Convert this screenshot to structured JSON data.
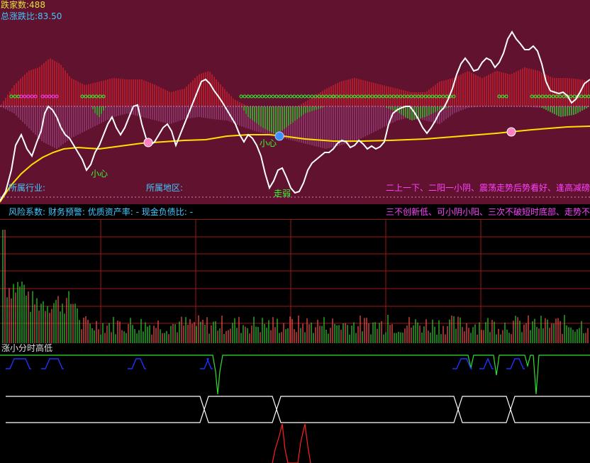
{
  "header": {
    "fall_count_label": "跌家数:",
    "fall_count_value": "488",
    "ratio_label": "总涨跌比:",
    "ratio_value": "83.50"
  },
  "annotations": {
    "xiaoxin_1": "小心",
    "xiaoxin_2": "小心",
    "zouruo": "走弱",
    "industry_label": "所属行业:",
    "region_label": "所属地区:",
    "tip_1": "二上一下、二阳一小阴、震荡走势后势看好、逢高减磅",
    "tip_2": "三不创新低、可小阴小阳、三次不破短时底部、走势不"
  },
  "risk_bar": {
    "text": "风险系数: 财务预警: 优质资产率: - 现金负债比: -"
  },
  "sub_panel": {
    "title": "涨小分时高低"
  },
  "colors": {
    "main_bg": "#60122e",
    "up": "#ff3030",
    "down": "#30ff30",
    "price": "#ffffff",
    "avg": "#ffe000",
    "text_yellow": "#e0e040",
    "text_cyan": "#40c8ff",
    "text_magenta": "#ff40ff",
    "grid": "#a01818"
  }
}
